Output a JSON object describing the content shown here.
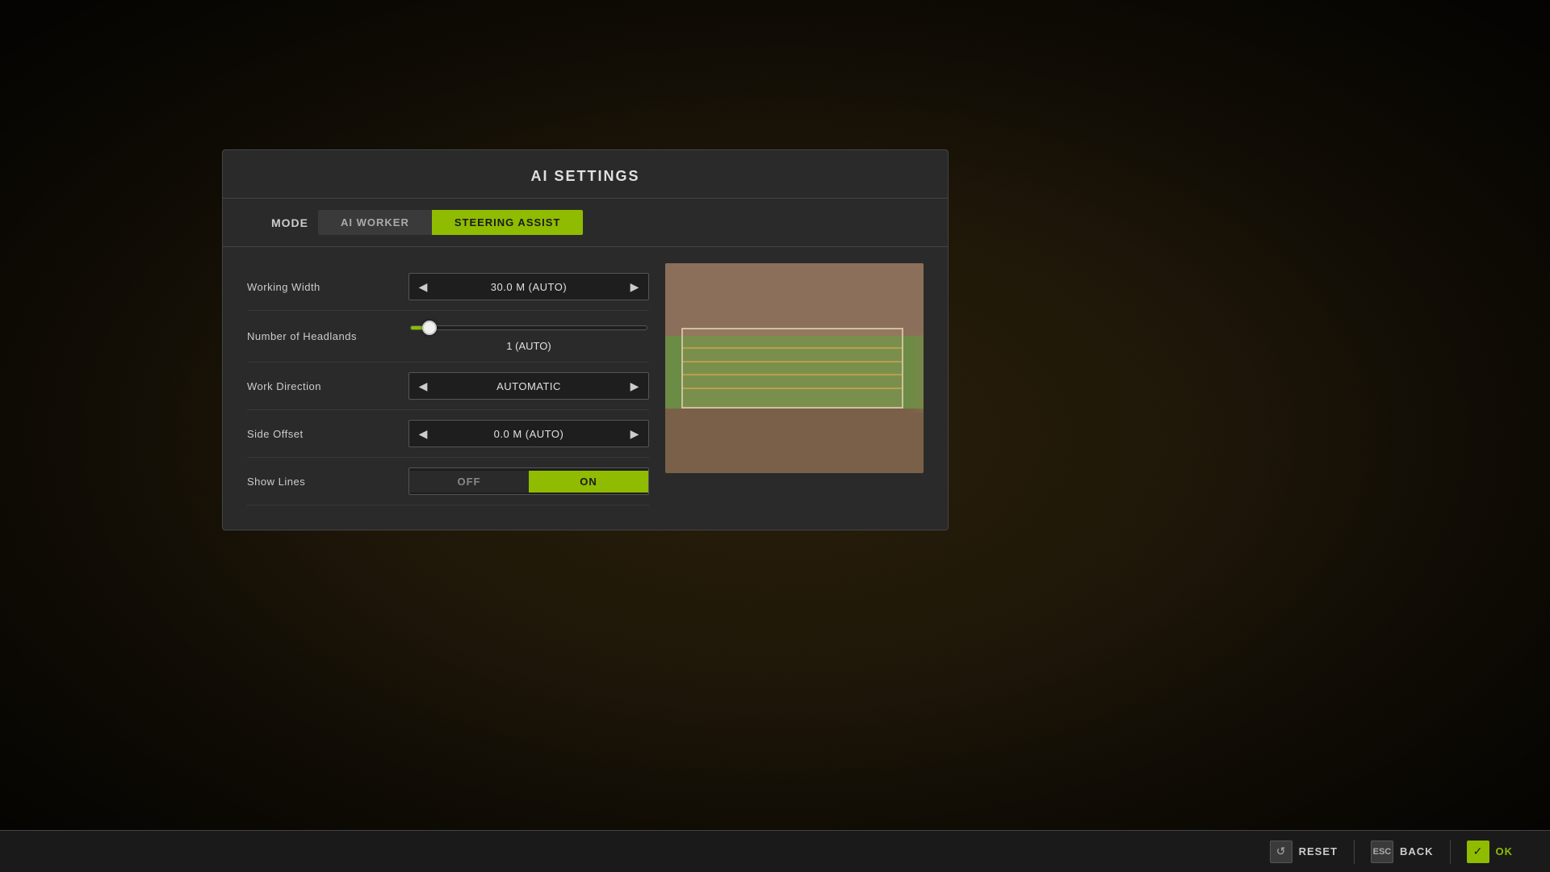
{
  "background": {
    "color": "#1a1208"
  },
  "dialog": {
    "title": "AI SETTINGS",
    "tabs": {
      "mode_label": "MODE",
      "ai_worker": "AI WORKER",
      "steering_assist": "STEERING ASSIST",
      "active_tab": "steering_assist"
    },
    "settings": {
      "working_width": {
        "label": "Working Width",
        "value": "30.0 M (AUTO)"
      },
      "number_of_headlands": {
        "label": "Number of Headlands",
        "value": "1 (AUTO)",
        "slider_percent": 8
      },
      "work_direction": {
        "label": "Work Direction",
        "value": "AUTOMATIC"
      },
      "side_offset": {
        "label": "Side Offset",
        "value": "0.0 M (AUTO)"
      },
      "show_lines": {
        "label": "Show Lines",
        "off_label": "OFF",
        "on_label": "ON",
        "active": "on"
      }
    }
  },
  "toolbar": {
    "reset_icon": "↺",
    "reset_label": "RESET",
    "esc_label": "ESC",
    "back_label": "BACK",
    "ok_icon": "↩",
    "ok_label": "OK"
  },
  "preview": {
    "lines_count": 4
  }
}
